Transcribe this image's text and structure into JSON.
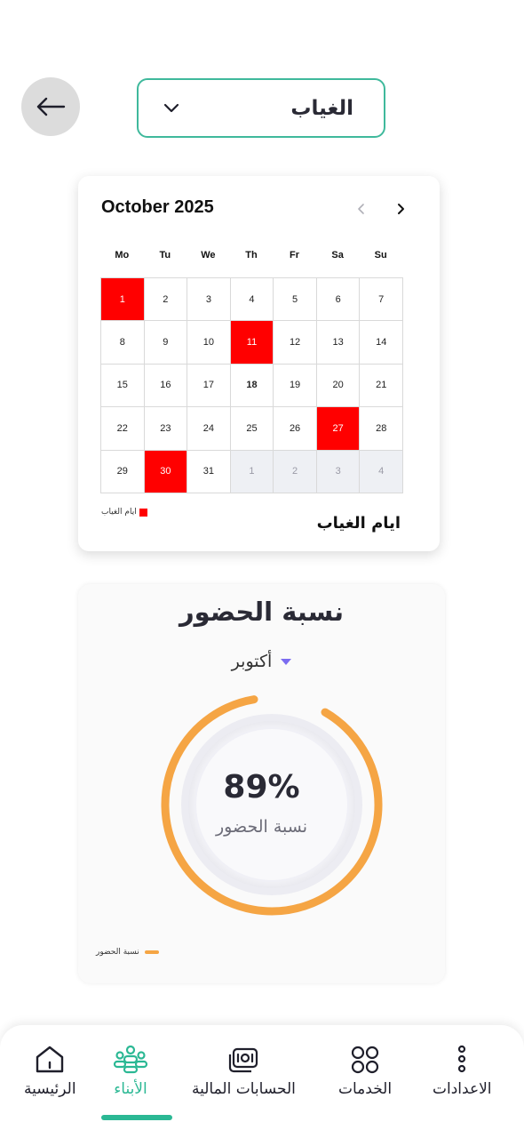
{
  "header": {
    "back_icon": "arrow-left-icon",
    "dropdown_value": "الغياب",
    "dropdown_icon": "chevron-down-icon",
    "accent_color": "#3fb99c"
  },
  "calendar": {
    "title": "October 2025",
    "prev_icon": "chevron-left-icon",
    "next_icon": "chevron-right-icon",
    "weekdays": [
      "Mo",
      "Tu",
      "We",
      "Th",
      "Fr",
      "Sa",
      "Su"
    ],
    "days": [
      {
        "d": "1",
        "absent": true
      },
      {
        "d": "2"
      },
      {
        "d": "3"
      },
      {
        "d": "4"
      },
      {
        "d": "5"
      },
      {
        "d": "6"
      },
      {
        "d": "7"
      },
      {
        "d": "8"
      },
      {
        "d": "9"
      },
      {
        "d": "10"
      },
      {
        "d": "11",
        "absent": true
      },
      {
        "d": "12"
      },
      {
        "d": "13"
      },
      {
        "d": "14"
      },
      {
        "d": "15"
      },
      {
        "d": "16"
      },
      {
        "d": "17"
      },
      {
        "d": "18",
        "today": true
      },
      {
        "d": "19"
      },
      {
        "d": "20"
      },
      {
        "d": "21"
      },
      {
        "d": "22"
      },
      {
        "d": "23"
      },
      {
        "d": "24"
      },
      {
        "d": "25"
      },
      {
        "d": "26"
      },
      {
        "d": "27",
        "absent": true
      },
      {
        "d": "28"
      },
      {
        "d": "29"
      },
      {
        "d": "30",
        "absent": true
      },
      {
        "d": "31"
      },
      {
        "d": "1",
        "other": true
      },
      {
        "d": "2",
        "other": true
      },
      {
        "d": "3",
        "other": true
      },
      {
        "d": "4",
        "other": true
      }
    ],
    "legend_label": "ايام الغياب",
    "footer_title": "ايام الغياب",
    "absent_color": "#ff0000"
  },
  "attendance": {
    "title": "نسبة الحضور",
    "month": "أكتوبر",
    "percent_text": "89%",
    "percent_value": 0.89,
    "percent_label": "نسبة الحضور",
    "legend_label": "نسبة الحضور",
    "gauge_color": "#f5a544"
  },
  "bottom_nav": {
    "items": [
      {
        "label": "الرئيسية",
        "icon": "home-icon"
      },
      {
        "label": "الأبناء",
        "icon": "children-icon",
        "active": true
      },
      {
        "label": "الحسابات المالية",
        "icon": "money-icon"
      },
      {
        "label": "الخدمات",
        "icon": "grid-icon"
      },
      {
        "label": "الاعدادات",
        "icon": "more-vertical-icon"
      }
    ],
    "active_color": "#2bb894"
  }
}
